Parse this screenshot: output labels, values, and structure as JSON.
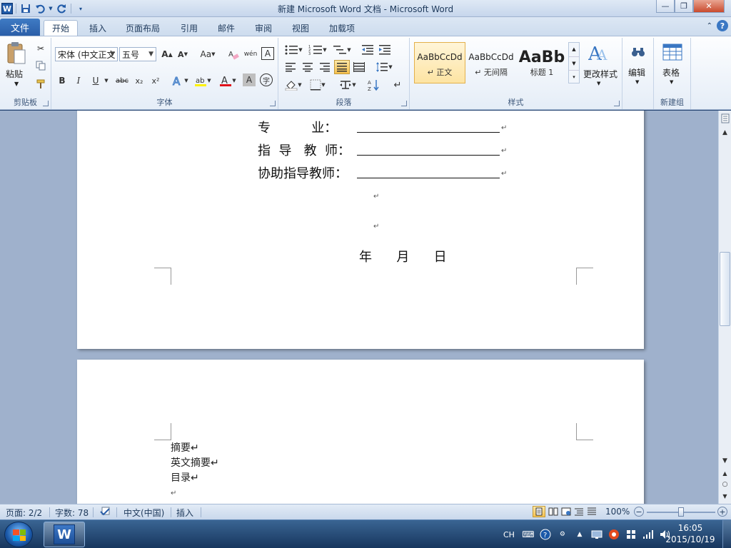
{
  "window": {
    "title": "新建 Microsoft Word 文档 - Microsoft Word",
    "minimize": "—",
    "restore": "❐",
    "close": "✕"
  },
  "qat": {
    "word_icon": "W",
    "save_icon": "save-icon",
    "undo_icon": "undo-icon",
    "redo_icon": "redo-icon"
  },
  "tabs": {
    "file": "文件",
    "home": "开始",
    "insert": "插入",
    "layout": "页面布局",
    "references": "引用",
    "mailings": "邮件",
    "review": "审阅",
    "view": "视图",
    "addins": "加载项",
    "help": "?"
  },
  "clipboard": {
    "paste": "粘贴",
    "group": "剪贴板"
  },
  "font": {
    "name": "宋体 (中文正文",
    "size": "五号",
    "group": "字体",
    "grow": "A",
    "shrink": "A",
    "case": "Aa",
    "bold": "B",
    "italic": "I",
    "underline": "U",
    "strike": "abc",
    "sub": "x₂",
    "sup": "x²",
    "wen": "wén",
    "char_border": "A",
    "shading": "A",
    "enclose": "字"
  },
  "paragraph": {
    "group": "段落"
  },
  "styles": {
    "group": "样式",
    "items": [
      {
        "sample": "AaBbCcDd",
        "name": "↵ 正文"
      },
      {
        "sample": "AaBbCcDd",
        "name": "↵ 无间隔"
      },
      {
        "sample": "AaBb",
        "name": "标题 1"
      }
    ],
    "change": "更改样式"
  },
  "editing": {
    "label": "编辑"
  },
  "newgroup": {
    "table": "表格",
    "group": "新建组"
  },
  "document": {
    "page1": {
      "major_label": "专          业：",
      "advisor_label": "指  导   教  师：",
      "co_advisor_label": "协助指导教师：",
      "mark": "↵",
      "date": "年      月      日"
    },
    "page2": {
      "lines": [
        "摘要↵",
        "英文摘要↵",
        "目录↵",
        "↵"
      ]
    }
  },
  "status": {
    "page": "页面: 2/2",
    "words": "字数: 78",
    "language": "中文(中国)",
    "mode": "插入",
    "zoom": "100%",
    "zoom_minus": "−",
    "zoom_plus": "+"
  },
  "taskbar": {
    "lang": "CH",
    "time": "16:05",
    "date": "2015/10/19"
  },
  "colors": {
    "file_tab": "#2a5ea8",
    "ribbon": "#e5edf7",
    "doc_bg": "#9fb1cc",
    "taskbar": "#17365e"
  }
}
